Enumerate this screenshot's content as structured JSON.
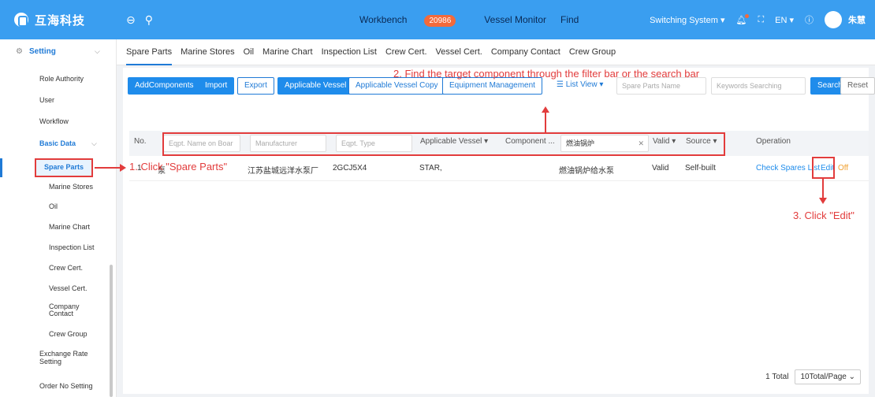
{
  "header": {
    "logo_text": "互海科技",
    "workbench_label": "Workbench",
    "workbench_count": "20986",
    "vessel_monitor": "Vessel Monitor",
    "find": "Find",
    "switching_system": "Switching System ▾",
    "language": "EN ▾",
    "user_name": "朱慧"
  },
  "sidebar": {
    "setting": "Setting",
    "items": [
      "Role Authority",
      "User",
      "Workflow"
    ],
    "basic_data": "Basic Data",
    "sub_items": [
      "Spare Parts",
      "Marine Stores",
      "Oil",
      "Marine Chart",
      "Inspection List",
      "Crew Cert.",
      "Vessel Cert.",
      "Company Contact",
      "Crew Group"
    ],
    "exchange_rate": "Exchange Rate Setting",
    "order_no": "Order No Setting"
  },
  "tabs": [
    "Spare Parts",
    "Marine Stores",
    "Oil",
    "Marine Chart",
    "Inspection List",
    "Crew Cert.",
    "Vessel Cert.",
    "Company Contact",
    "Crew Group"
  ],
  "toolbar": {
    "add": "AddComponents",
    "import": "Import",
    "export": "Export",
    "applicable_vessel": "Applicable Vessel",
    "applicable_vessel_copy": "Applicable Vessel Copy",
    "equipment_management": "Equipment Management",
    "list_view": "List View ▾",
    "spare_parts_name_ph": "Spare Parts Name",
    "keywords_ph": "Keywords Searching",
    "search": "Search",
    "reset": "Reset"
  },
  "table": {
    "headers": {
      "no": "No.",
      "eqpt_name_ph": "Eqpt. Name on Boar",
      "manufacturer_ph": "Manufacturer",
      "eqpt_type_ph": "Eqpt. Type",
      "applicable_vessel": "Applicable Vessel ▾",
      "component": "Component ...",
      "component_filter_value": "燃油锅炉",
      "valid": "Valid ▾",
      "source": "Source ▾",
      "operation": "Operation"
    },
    "row": {
      "no": "1",
      "eqpt_name": "泵",
      "manufacturer": "江苏盐城远洋水泵厂",
      "eqpt_type": "2GCJ5X4",
      "vessel": "STAR,",
      "component": "燃油锅炉给水泵",
      "valid": "Valid",
      "source": "Self-built",
      "check_spares": "Check Spares List",
      "edit": "Edit",
      "off": "Off"
    }
  },
  "pagination": {
    "total": "1 Total",
    "per_page": "10Total/Page ⌄"
  },
  "annotations": {
    "step1": "1. Click \"Spare Parts\"",
    "step2": "2. Find the target component through the filter bar or the search bar",
    "step3": "3. Click \"Edit\""
  },
  "colors": {
    "topbar": "#3a9ef0",
    "primary": "#1f8ceb",
    "annotation_red": "#e23c3c",
    "badge": "#f36a3b"
  }
}
